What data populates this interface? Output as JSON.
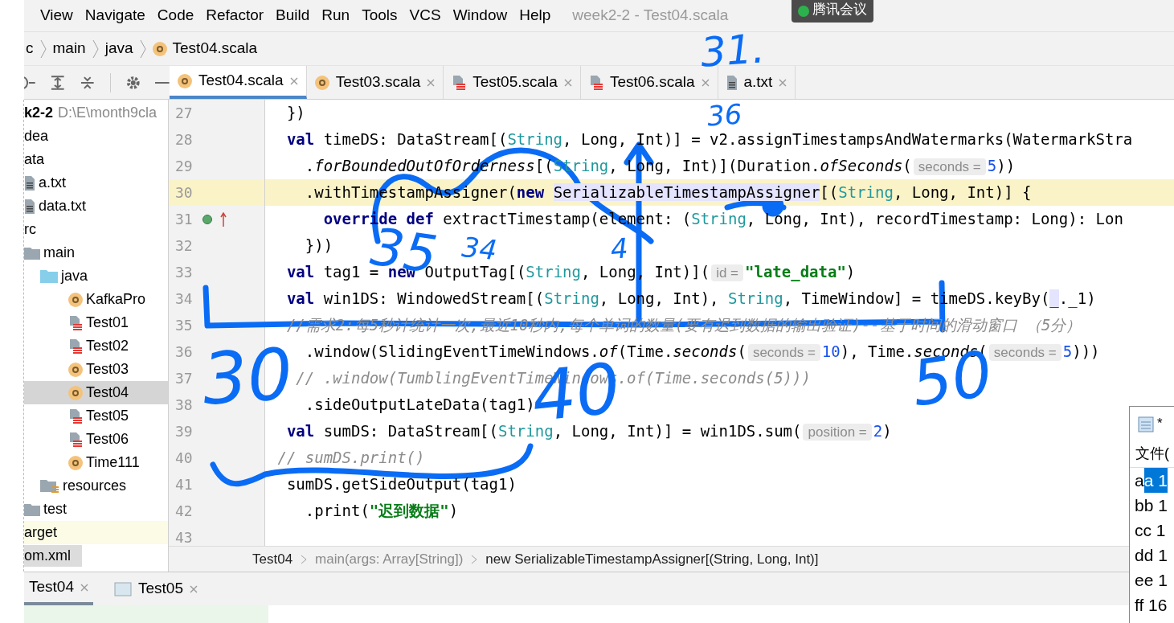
{
  "menu": [
    "View",
    "Navigate",
    "Code",
    "Refactor",
    "Build",
    "Run",
    "Tools",
    "VCS",
    "Window",
    "Help"
  ],
  "window_title": "week2-2 - Test04.scala",
  "overlay_badge": "腾讯会议",
  "breadcrumb": [
    {
      "label": "c",
      "kind": "text"
    },
    {
      "label": "main",
      "kind": "text"
    },
    {
      "label": "java",
      "kind": "text"
    },
    {
      "label": "Test04.scala",
      "kind": "scala"
    }
  ],
  "editor_tabs": [
    {
      "label": "Test04.scala",
      "kind": "scala",
      "selected": true
    },
    {
      "label": "Test03.scala",
      "kind": "scala",
      "selected": false
    },
    {
      "label": "Test05.scala",
      "kind": "java",
      "selected": false
    },
    {
      "label": "Test06.scala",
      "kind": "java",
      "selected": false
    },
    {
      "label": "a.txt",
      "kind": "text",
      "selected": false
    }
  ],
  "project_tree": {
    "root": "k2-2",
    "path": "D:\\E\\month9cla",
    "children": [
      {
        "label": "dea",
        "kind": "folder",
        "selected": false
      },
      {
        "label": "ata",
        "kind": "folder",
        "selected": false,
        "children": [
          {
            "label": "a.txt",
            "kind": "text",
            "selected": false
          },
          {
            "label": "data.txt",
            "kind": "text",
            "selected": false
          }
        ]
      },
      {
        "label": "rc",
        "kind": "folder",
        "selected": false,
        "children": [
          {
            "label": "main",
            "kind": "folder",
            "selected": false,
            "children": [
              {
                "label": "java",
                "kind": "source",
                "selected": false,
                "children": [
                  {
                    "label": "KafkaPro",
                    "kind": "scala",
                    "selected": false
                  },
                  {
                    "label": "Test01",
                    "kind": "java",
                    "selected": false
                  },
                  {
                    "label": "Test02",
                    "kind": "java",
                    "selected": false
                  },
                  {
                    "label": "Test03",
                    "kind": "scala",
                    "selected": false
                  },
                  {
                    "label": "Test04",
                    "kind": "scala",
                    "selected": true
                  },
                  {
                    "label": "Test05",
                    "kind": "java",
                    "selected": false
                  },
                  {
                    "label": "Test06",
                    "kind": "java",
                    "selected": false
                  },
                  {
                    "label": "Time111",
                    "kind": "scala",
                    "selected": false
                  }
                ]
              },
              {
                "label": "resources",
                "kind": "resources",
                "selected": false
              }
            ]
          },
          {
            "label": "test",
            "kind": "folder",
            "selected": false
          }
        ]
      },
      {
        "label": "arget",
        "kind": "excluded",
        "selected": false
      },
      {
        "label": "om.xml",
        "kind": "xml",
        "selected": false
      }
    ]
  },
  "code_lines": [
    {
      "number": "27",
      "current": false,
      "parts": [
        {
          "text": "  })",
          "kind": "plain"
        }
      ]
    },
    {
      "number": "28",
      "current": false,
      "parts": [
        {
          "text": "  val",
          "kind": "keyword"
        },
        {
          "text": " timeDS: DataStream[(",
          "kind": "plain"
        },
        {
          "text": "String",
          "kind": "type"
        },
        {
          "text": ", Long, Int)] = v2.assignTimestampsAndWatermarks(WatermarkStra",
          "kind": "plain"
        }
      ]
    },
    {
      "number": "29",
      "current": false,
      "parts": [
        {
          "text": "    .",
          "kind": "plain"
        },
        {
          "text": "forBoundedOutOfOrderness",
          "kind": "italic"
        },
        {
          "text": "[(",
          "kind": "plain"
        },
        {
          "text": "String",
          "kind": "type"
        },
        {
          "text": ", Long, Int)](Duration.",
          "kind": "plain"
        },
        {
          "text": "ofSeconds",
          "kind": "italic"
        },
        {
          "text": "(",
          "kind": "plain"
        },
        {
          "text": "seconds =",
          "kind": "hint"
        },
        {
          "text": "5",
          "kind": "number"
        },
        {
          "text": "))",
          "kind": "plain"
        }
      ]
    },
    {
      "number": "30",
      "current": true,
      "parts": [
        {
          "text": "    .withTimestampAssigner(",
          "kind": "plain"
        },
        {
          "text": "new ",
          "kind": "keyword"
        },
        {
          "text": "SerializableTimestampAssigner",
          "kind": "highlight"
        },
        {
          "text": "[(",
          "kind": "plain"
        },
        {
          "text": "String",
          "kind": "type"
        },
        {
          "text": ", Long, Int)] {",
          "kind": "plain"
        }
      ]
    },
    {
      "number": "31",
      "current": false,
      "parts": [
        {
          "text": "      override def",
          "kind": "keyword"
        },
        {
          "text": " extractTimestamp(element: (",
          "kind": "plain"
        },
        {
          "text": "String",
          "kind": "type"
        },
        {
          "text": ", Long, Int), recordTimestamp: Long): Lon",
          "kind": "plain"
        }
      ]
    },
    {
      "number": "32",
      "current": false,
      "parts": [
        {
          "text": "    }))",
          "kind": "plain"
        }
      ]
    },
    {
      "number": "33",
      "current": false,
      "parts": [
        {
          "text": "  val",
          "kind": "keyword"
        },
        {
          "text": " tag1 = ",
          "kind": "plain"
        },
        {
          "text": "new",
          "kind": "keyword"
        },
        {
          "text": " OutputTag[(",
          "kind": "plain"
        },
        {
          "text": "String",
          "kind": "type"
        },
        {
          "text": ", Long, Int)](",
          "kind": "plain"
        },
        {
          "text": "id =",
          "kind": "hint"
        },
        {
          "text": "\"late_data\"",
          "kind": "string"
        },
        {
          "text": ")",
          "kind": "plain"
        }
      ]
    },
    {
      "number": "34",
      "current": false,
      "parts": [
        {
          "text": "  val",
          "kind": "keyword"
        },
        {
          "text": " win1DS: WindowedStream[(",
          "kind": "plain"
        },
        {
          "text": "String",
          "kind": "type"
        },
        {
          "text": ", Long, Int), ",
          "kind": "plain"
        },
        {
          "text": "String",
          "kind": "type"
        },
        {
          "text": ", TimeWindow] = timeDS.keyBy(",
          "kind": "plain"
        },
        {
          "text": "_",
          "kind": "highlight"
        },
        {
          "text": "._1)",
          "kind": "plain"
        }
      ]
    },
    {
      "number": "35",
      "current": false,
      "parts": [
        {
          "text": "  //需求2:每5秒计统计一次,最近10秒内,每个单词的数量(要有迟到数据的输出验证)--基于时间的滑动窗口 （5分）",
          "kind": "comment"
        }
      ]
    },
    {
      "number": "36",
      "current": false,
      "parts": [
        {
          "text": "    .window(SlidingEventTimeWindows.",
          "kind": "plain"
        },
        {
          "text": "of",
          "kind": "italic"
        },
        {
          "text": "(Time.",
          "kind": "plain"
        },
        {
          "text": "seconds",
          "kind": "italic"
        },
        {
          "text": "(",
          "kind": "plain"
        },
        {
          "text": "seconds =",
          "kind": "hint"
        },
        {
          "text": "10",
          "kind": "number"
        },
        {
          "text": "), Time.",
          "kind": "plain"
        },
        {
          "text": "seconds",
          "kind": "italic"
        },
        {
          "text": "(",
          "kind": "plain"
        },
        {
          "text": "seconds =",
          "kind": "hint"
        },
        {
          "text": "5",
          "kind": "number"
        },
        {
          "text": ")))",
          "kind": "plain"
        }
      ]
    },
    {
      "number": "37",
      "current": false,
      "parts": [
        {
          "text": "   // .window(TumblingEventTimeWindows.of(Time.seconds(5)))",
          "kind": "comment"
        }
      ]
    },
    {
      "number": "38",
      "current": false,
      "parts": [
        {
          "text": "    .sideOutputLateData(tag1)",
          "kind": "plain"
        }
      ]
    },
    {
      "number": "39",
      "current": false,
      "parts": [
        {
          "text": "  val",
          "kind": "keyword"
        },
        {
          "text": " sumDS: DataStream[(",
          "kind": "plain"
        },
        {
          "text": "String",
          "kind": "type"
        },
        {
          "text": ", Long, Int)] = win1DS.sum(",
          "kind": "plain"
        },
        {
          "text": "position =",
          "kind": "hint"
        },
        {
          "text": "2",
          "kind": "number"
        },
        {
          "text": ")",
          "kind": "plain"
        }
      ]
    },
    {
      "number": "40",
      "current": false,
      "parts": [
        {
          "text": " // sumDS.print()",
          "kind": "comment"
        }
      ]
    },
    {
      "number": "41",
      "current": false,
      "parts": [
        {
          "text": "  sumDS.getSideOutput(tag1)",
          "kind": "plain"
        }
      ]
    },
    {
      "number": "42",
      "current": false,
      "parts": [
        {
          "text": "    .print(",
          "kind": "plain"
        },
        {
          "text": "\"迟到数据\"",
          "kind": "string"
        },
        {
          "text": ")",
          "kind": "plain"
        }
      ]
    },
    {
      "number": "43",
      "current": false
    }
  ],
  "editor_breadcrumb": [
    "Test04",
    "main(args: Array[String])",
    "new SerializableTimestampAssigner[(String, Long, Int)]"
  ],
  "run_tabs": [
    {
      "label": "Test04",
      "selected": true
    },
    {
      "label": "Test05",
      "selected": false
    }
  ],
  "notepad": {
    "title": "*",
    "menu": "文件(",
    "lines": [
      {
        "text": "a",
        "selected_text": "a 1"
      },
      {
        "text": "bb 1"
      },
      {
        "text": "cc 1"
      },
      {
        "text": "dd 1"
      },
      {
        "text": "ee 1"
      },
      {
        "text": "ff 16"
      }
    ]
  },
  "annotations": [
    "31.",
    "36",
    "35",
    "34",
    "4",
    "30",
    "40",
    "50"
  ]
}
